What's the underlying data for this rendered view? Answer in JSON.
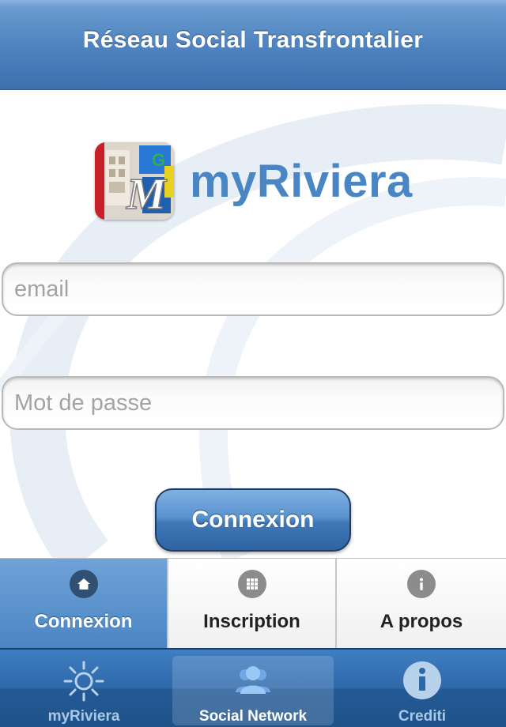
{
  "navbar": {
    "title": "Réseau Social Transfrontalier"
  },
  "brand": {
    "name": "myRiviera",
    "color": "#4a86c4"
  },
  "login": {
    "email_placeholder": "email",
    "password_placeholder": "Mot de passe",
    "submit_label": "Connexion"
  },
  "segments": [
    {
      "label": "Connexion",
      "icon": "home-icon",
      "active": true
    },
    {
      "label": "Inscription",
      "icon": "grid-icon",
      "active": false
    },
    {
      "label": "A propos",
      "icon": "info-icon",
      "active": false
    }
  ],
  "tabbar": {
    "items": [
      {
        "label": "myRiviera",
        "icon": "sun-icon",
        "selected": false
      },
      {
        "label": "Social Network",
        "icon": "people-icon",
        "selected": true
      },
      {
        "label": "Crediti",
        "icon": "info-circle-icon",
        "selected": false
      }
    ]
  },
  "colors": {
    "accent": "#4f84c0",
    "tabbar": "#2e68a9"
  }
}
